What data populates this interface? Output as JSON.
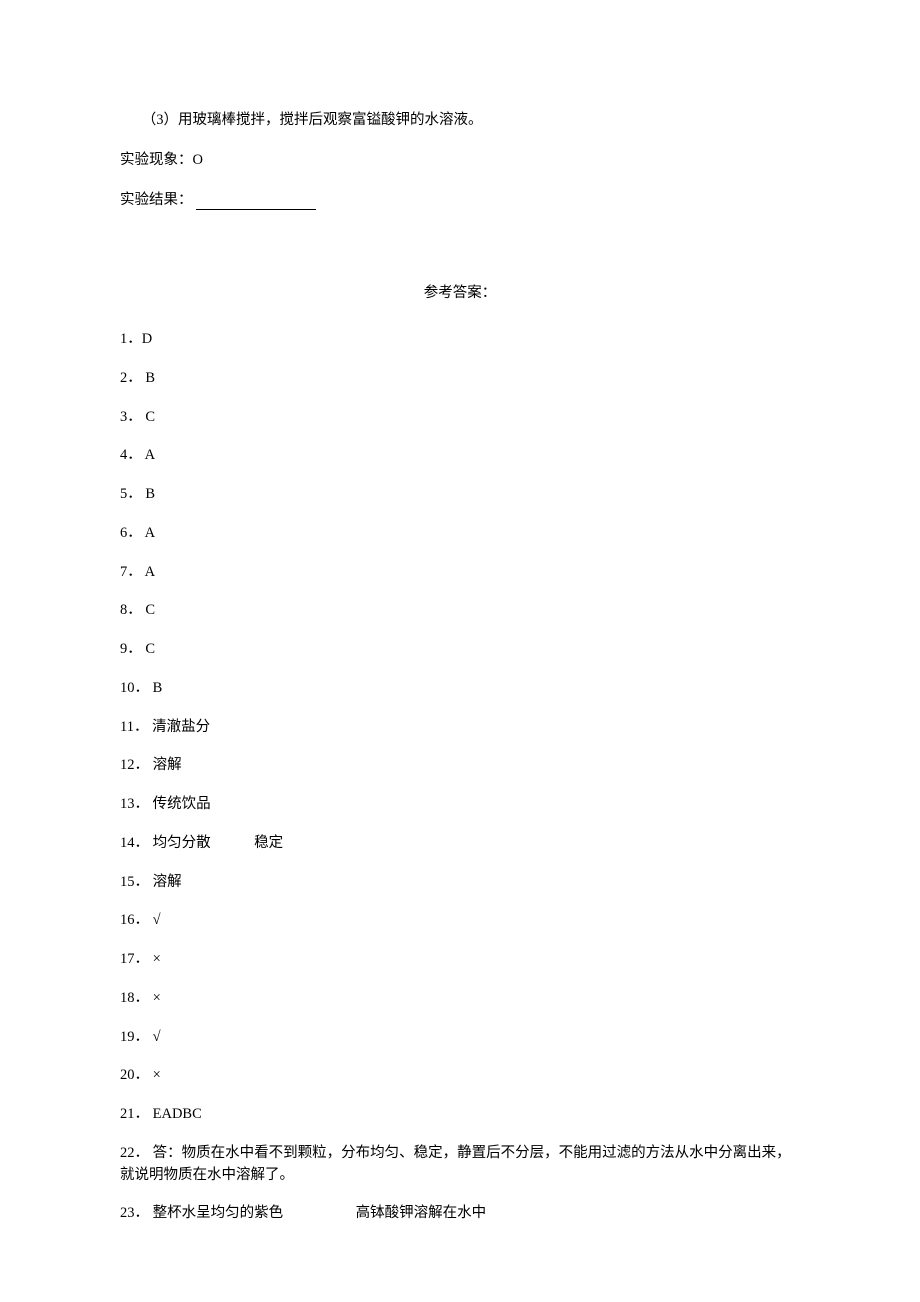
{
  "q3": {
    "text": "（3）用玻璃棒搅拌，搅拌后观察富镒酸钾的水溶液。"
  },
  "phenomenon": {
    "label": "实验现象：",
    "value": "O"
  },
  "result": {
    "label": "实验结果："
  },
  "answer_title": "参考答案：",
  "answers": [
    {
      "num": "1．",
      "text": "D"
    },
    {
      "num": "2．",
      "text": " B"
    },
    {
      "num": "3．",
      "text": " C"
    },
    {
      "num": "4．",
      "text": " A"
    },
    {
      "num": "5．",
      "text": " B"
    },
    {
      "num": "6．",
      "text": " A"
    },
    {
      "num": "7．",
      "text": " A"
    },
    {
      "num": "8．",
      "text": " C"
    },
    {
      "num": "9．",
      "text": " C"
    },
    {
      "num": "10．",
      "text": " B"
    },
    {
      "num": "11．",
      "text": " 清澈盐分"
    },
    {
      "num": "12．",
      "text": " 溶解"
    },
    {
      "num": "13．",
      "text": " 传统饮品"
    },
    {
      "num": "14．",
      "text": " 均匀分散　　　稳定"
    },
    {
      "num": "15．",
      "text": " 溶解"
    },
    {
      "num": "16．",
      "text": " √"
    },
    {
      "num": "17．",
      "text": " ×"
    },
    {
      "num": "18．",
      "text": " ×"
    },
    {
      "num": "19．",
      "text": " √"
    },
    {
      "num": "20．",
      "text": " ×"
    },
    {
      "num": "21．",
      "text": " EADBC"
    }
  ],
  "answer22": {
    "num": "22．",
    "text": " 答：物质在水中看不到颗粒，分布均匀、稳定，静置后不分层，不能用过滤的方法从水中分离出来，就说明物质在水中溶解了。"
  },
  "answer23": {
    "num": "23．",
    "text": " 整杯水呈均匀的紫色　　　　　高钵酸钾溶解在水中"
  }
}
